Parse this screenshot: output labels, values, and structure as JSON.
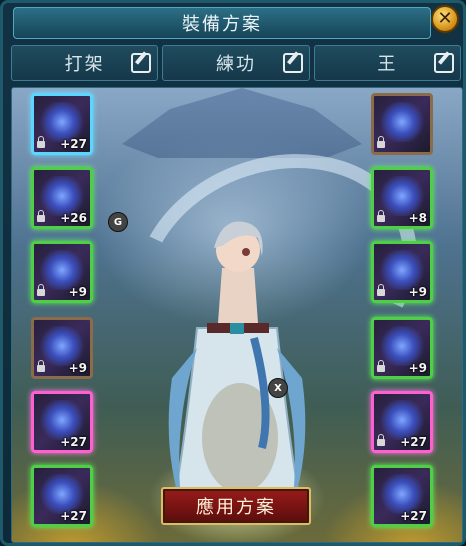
{
  "window": {
    "title": "裝備方案",
    "close_label": "✕"
  },
  "tabs": [
    {
      "label": "打架",
      "edit_icon": "edit-icon"
    },
    {
      "label": "練功",
      "edit_icon": "edit-icon"
    },
    {
      "label": "王",
      "edit_icon": "edit-icon"
    }
  ],
  "left_slots": [
    {
      "level": "+27",
      "frame": "cyan",
      "locked": true
    },
    {
      "level": "+26",
      "frame": "green",
      "locked": true
    },
    {
      "level": "+9",
      "frame": "green",
      "locked": true
    },
    {
      "level": "+9",
      "frame": "plain",
      "locked": true
    },
    {
      "level": "+27",
      "frame": "pink",
      "locked": false
    },
    {
      "level": "+27",
      "frame": "green",
      "locked": false
    }
  ],
  "right_slots": [
    {
      "level": "",
      "frame": "plain",
      "locked": true
    },
    {
      "level": "+8",
      "frame": "green",
      "locked": true
    },
    {
      "level": "+9",
      "frame": "green",
      "locked": true
    },
    {
      "level": "+9",
      "frame": "green",
      "locked": true
    },
    {
      "level": "+27",
      "frame": "pink",
      "locked": true
    },
    {
      "level": "+27",
      "frame": "green",
      "locked": false
    }
  ],
  "markers": {
    "g": "G",
    "x": "X"
  },
  "apply_button": {
    "label": "應用方案"
  },
  "colors": {
    "accent": "#4fa8c4",
    "button": "#9a1b1b",
    "gold": "#e2b86a"
  }
}
